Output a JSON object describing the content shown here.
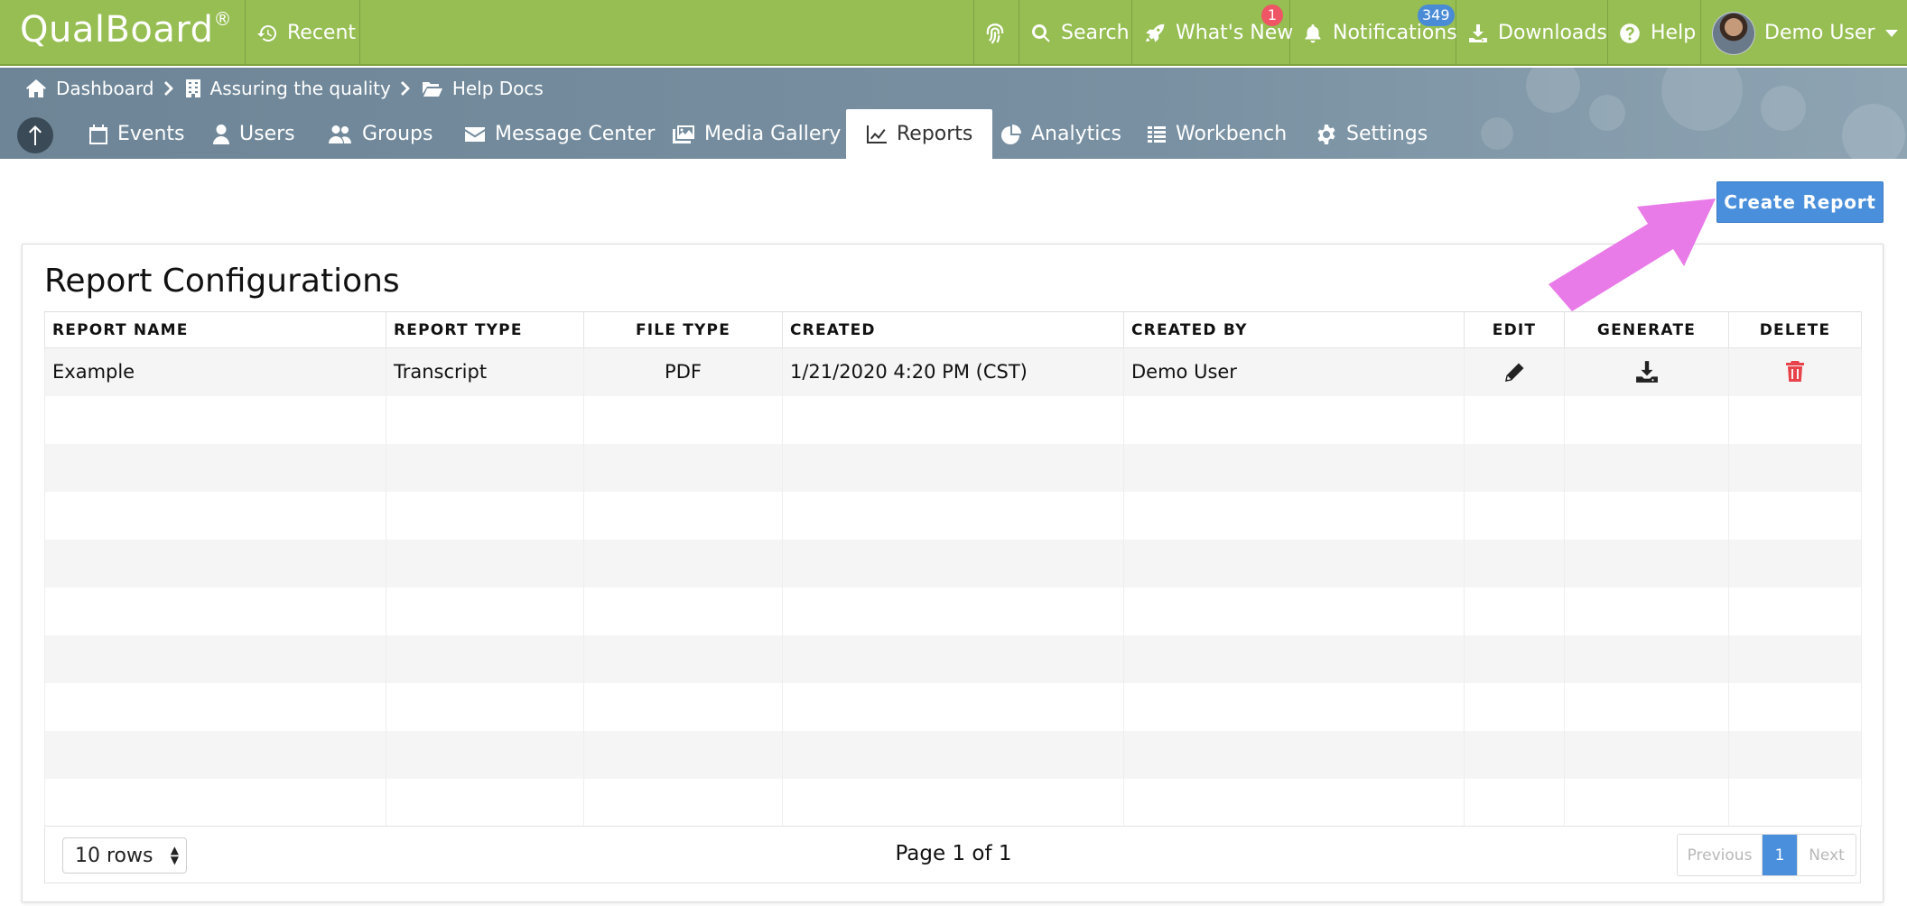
{
  "app": {
    "logo": "QualBoard",
    "logo_mark": "®"
  },
  "topbar": {
    "recent": "Recent",
    "search": "Search",
    "whats_new": "What's New",
    "whats_new_badge": "1",
    "notifications": "Notifications",
    "notifications_badge": "349",
    "downloads": "Downloads",
    "help": "Help",
    "user": "Demo User"
  },
  "breadcrumb": [
    "Dashboard",
    "Assuring the quality",
    "Help Docs"
  ],
  "nav": {
    "tabs": [
      "Events",
      "Users",
      "Groups",
      "Message Center",
      "Media Gallery",
      "Reports",
      "Analytics",
      "Workbench",
      "Settings"
    ],
    "active": "Reports"
  },
  "actions": {
    "create_report": "Create Report"
  },
  "panel": {
    "title": "Report Configurations",
    "columns": [
      "REPORT NAME",
      "REPORT TYPE",
      "FILE TYPE",
      "CREATED",
      "CREATED BY",
      "EDIT",
      "GENERATE",
      "DELETE"
    ],
    "rows": [
      {
        "name": "Example",
        "type": "Transcript",
        "file_type": "PDF",
        "created": "1/21/2020 4:20 PM (CST)",
        "created_by": "Demo User"
      }
    ]
  },
  "footer": {
    "rows_select": "10 rows",
    "page_info": "Page 1 of 1",
    "previous": "Previous",
    "current_page": "1",
    "next": "Next"
  },
  "colors": {
    "topbar": "#96be52",
    "subbar": "#7890a1",
    "accent": "#4a8fdb",
    "delete": "#e8434b",
    "annotation_arrow": "#e97be8"
  },
  "icons": {
    "recent": "history-icon",
    "fingerprint": "fingerprint-icon",
    "search": "search-icon",
    "whats_new": "rocket-icon",
    "notifications": "bell-icon",
    "downloads": "download-icon",
    "help": "question-circle-icon",
    "user_menu": "caret-down-icon",
    "edit": "pencil-icon",
    "generate": "download-icon",
    "delete": "trash-icon"
  }
}
